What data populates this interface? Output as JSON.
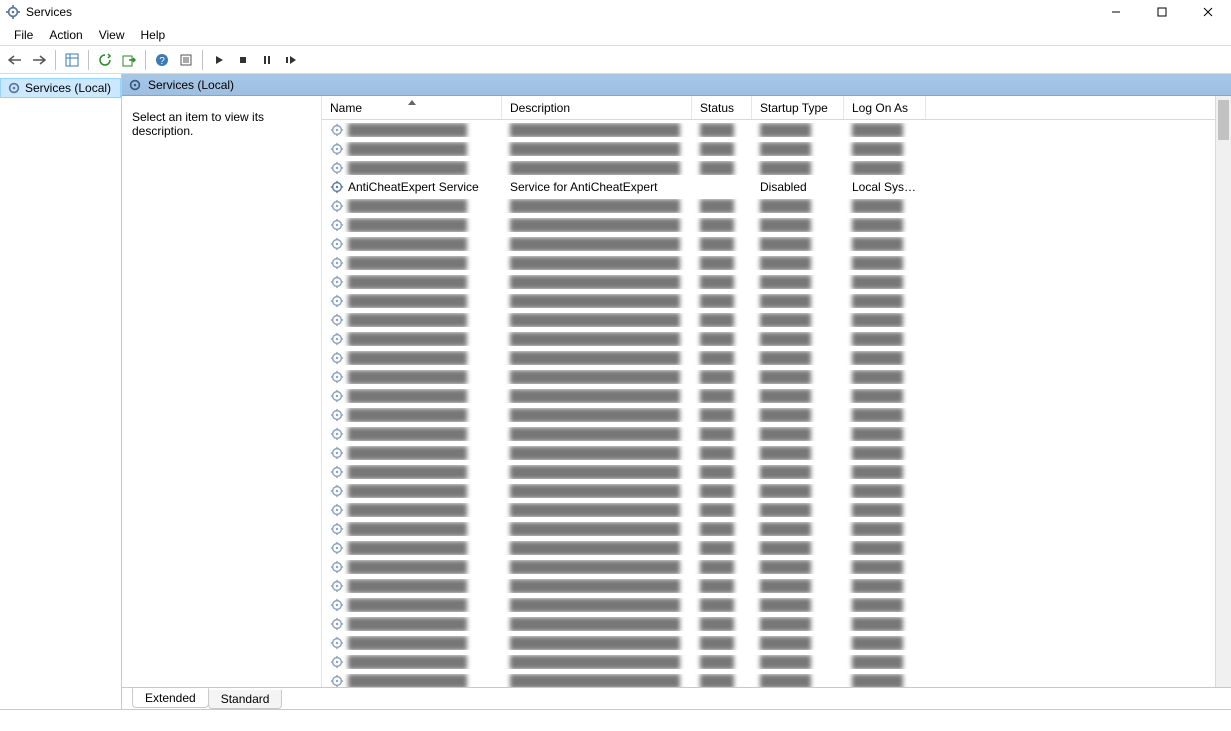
{
  "window": {
    "title": "Services"
  },
  "menu": {
    "file": "File",
    "action": "Action",
    "view": "View",
    "help": "Help"
  },
  "tree": {
    "root": "Services (Local)"
  },
  "panel": {
    "header": "Services (Local)"
  },
  "descpane": {
    "placeholder": "Select an item to view its description."
  },
  "columns": {
    "name": "Name",
    "description": "Description",
    "status": "Status",
    "startup": "Startup Type",
    "logon": "Log On As"
  },
  "focused_row": {
    "name": "AntiCheatExpert Service",
    "description": "Service for AntiCheatExpert",
    "status": "",
    "startup": "Disabled",
    "logon": "Local Syste..."
  },
  "tabs": {
    "extended": "Extended",
    "standard": "Standard"
  },
  "blur_rows_before": 3,
  "blur_rows_after": 26
}
